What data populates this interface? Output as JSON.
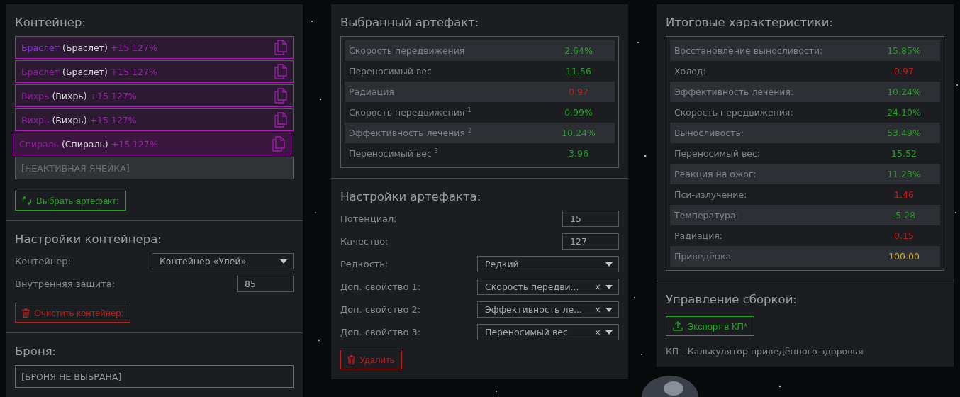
{
  "container_panel": {
    "title": "Контейнер:",
    "slots": [
      {
        "name": "Браслет",
        "type": "(Браслет)",
        "stats": "+15 127%",
        "selected": true,
        "dragging": false
      },
      {
        "name": "Браслет",
        "type": "(Браслет)",
        "stats": "+15 127%",
        "selected": false,
        "dragging": false
      },
      {
        "name": "Вихрь",
        "type": "(Вихрь)",
        "stats": "+15 127%",
        "selected": false,
        "dragging": false
      },
      {
        "name": "Вихрь",
        "type": "(Вихрь)",
        "stats": "+15 127%",
        "selected": false,
        "dragging": false
      },
      {
        "name": "Спираль",
        "type": "(Спираль)",
        "stats": "+15 127%",
        "selected": false,
        "dragging": true
      }
    ],
    "inactive_slot": "[НЕАКТИВНАЯ ЯЧЕЙКА]",
    "choose_button": "Выбрать артефакт:"
  },
  "container_settings": {
    "title": "Настройки контейнера:",
    "fields": [
      {
        "kind": "select",
        "label": "Контейнер:",
        "value": "Контейнер «Улей»"
      },
      {
        "kind": "input",
        "label": "Внутренняя защита:",
        "value": "85"
      }
    ],
    "clear_button": "Очистить контейнер:"
  },
  "armor": {
    "title": "Броня:",
    "value": "[БРОНЯ НЕ ВЫБРАНА]"
  },
  "selected_artifact": {
    "title": "Выбранный артефакт:",
    "stats": [
      {
        "label": "Скорость передвижения",
        "value": "2.64%",
        "color": "#21a121"
      },
      {
        "label": "Переносимый вес",
        "value": "11.56",
        "color": "#21a121"
      },
      {
        "label": "Радиация",
        "value": "0.97",
        "color": "#c81d1d"
      },
      {
        "label": "Скорость передвижения $^{1}$",
        "value": "0.99%",
        "color": "#21a121"
      },
      {
        "label": "Эффективность лечения $^{2}$",
        "value": "10.24%",
        "color": "#21a121"
      },
      {
        "label": "Переносимый вес $^{3}$",
        "value": "3.96",
        "color": "#21a121"
      }
    ]
  },
  "artifact_settings": {
    "title": "Настройки артефакта:",
    "fields": [
      {
        "kind": "input",
        "label": "Потенциал:",
        "value": "15"
      },
      {
        "kind": "input",
        "label": "Качество:",
        "value": "127"
      },
      {
        "kind": "select",
        "label": "Редкость:",
        "value": "Редкий"
      },
      {
        "kind": "clearable",
        "label": "Доп. свойство 1:",
        "value": "Скорость передви...",
        "clear": "×"
      },
      {
        "kind": "clearable",
        "label": "Доп. свойство 2:",
        "value": "Эффективность ле...",
        "clear": "×"
      },
      {
        "kind": "clearable",
        "label": "Доп. свойство 3:",
        "value": "Переносимый вес",
        "clear": "×"
      }
    ],
    "delete_button": "Удалить"
  },
  "totals": {
    "title": "Итоговые характеристики:",
    "stats": [
      {
        "label": "Восстановление выносливости:",
        "value": "15.85%",
        "color": "#21a121"
      },
      {
        "label": "Холод:",
        "value": "0.97",
        "color": "#c81d1d"
      },
      {
        "label": "Эффективность лечения:",
        "value": "10.24%",
        "color": "#21a121"
      },
      {
        "label": "Скорость передвижения:",
        "value": "24.10%",
        "color": "#21a121"
      },
      {
        "label": "Выносливость:",
        "value": "53.49%",
        "color": "#21a121"
      },
      {
        "label": "Переносимый вес:",
        "value": "15.52",
        "color": "#21a121"
      },
      {
        "label": "Реакция на ожог:",
        "value": "11.23%",
        "color": "#21a121"
      },
      {
        "label": "Пси-излучение:",
        "value": "1.46",
        "color": "#c81d1d"
      },
      {
        "label": "Температура:",
        "value": "-5.28",
        "color": "#21a121"
      },
      {
        "label": "Радиация:",
        "value": "0.15",
        "color": "#c81d1d"
      },
      {
        "label": "Приведёнка",
        "value": "100.00",
        "color": "#d9a91c"
      }
    ]
  },
  "build": {
    "title": "Управление сборкой:",
    "export_button": "Экспорт в КП*",
    "note": "КП - Калькулятор приведённого здоровья"
  }
}
